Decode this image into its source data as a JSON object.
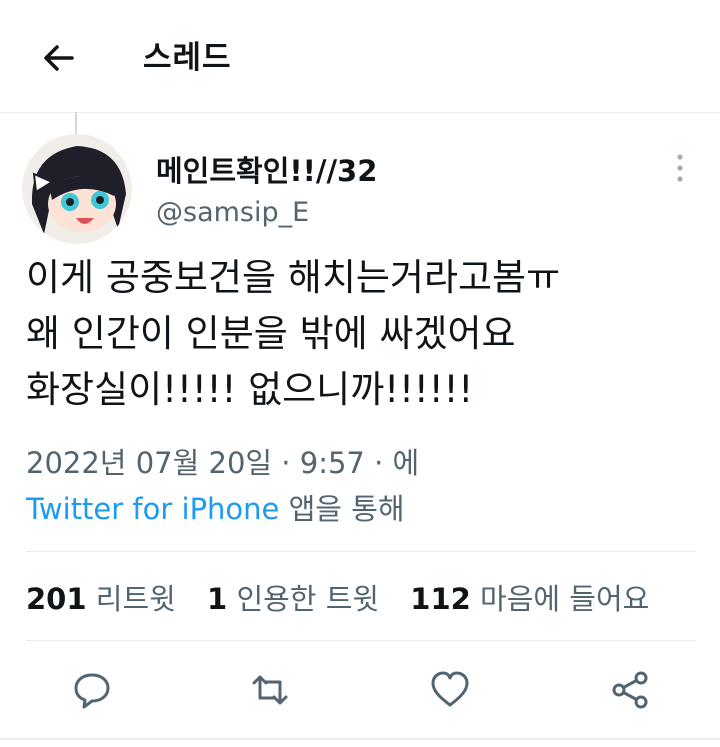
{
  "header": {
    "title": "스레드"
  },
  "tweet": {
    "author_name": "메인트확인!!//32",
    "author_handle": "@samsip_E",
    "text_lines": [
      "이게 공중보건을 해치는거라고봄ㅠ",
      "왜 인간이 인분을 밖에 싸겠어요",
      "화장실이!!!!! 없으니까!!!!!!"
    ],
    "date_line": "2022년 07월 20일 · 9:57 · 에",
    "source_app": "Twitter for iPhone",
    "source_suffix": " 앱을 통해"
  },
  "stats": {
    "retweets": "201",
    "retweets_label": "리트윗",
    "quotes": "1",
    "quotes_label": "인용한 트윗",
    "likes": "112",
    "likes_label": "마음에 들어요"
  },
  "colors": {
    "link": "#1d9bf0",
    "secondary": "#536471",
    "divider": "#e6ecf0"
  },
  "icons": [
    "back-arrow-icon",
    "more-vertical-icon",
    "reply-icon",
    "retweet-icon",
    "like-icon",
    "share-icon"
  ]
}
